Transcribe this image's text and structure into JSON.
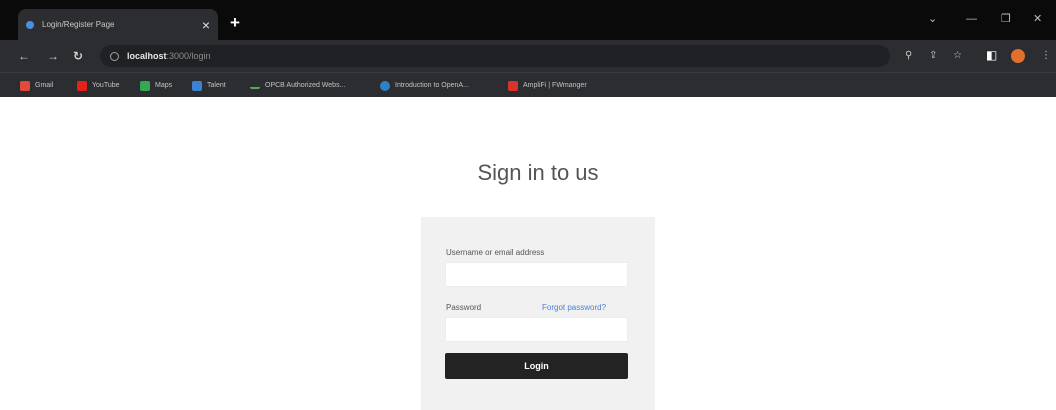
{
  "browser": {
    "tab_title": "Login/Register Page",
    "url_host": "localhost",
    "url_rest": ":3000/login",
    "bookmarks": [
      {
        "label": "Gmail",
        "color": "#e24a3b"
      },
      {
        "label": "YouTube",
        "color": "#e62117"
      },
      {
        "label": "Maps",
        "color": "#34a853"
      },
      {
        "label": "Talent",
        "color": "#3b82d6"
      },
      {
        "label": "OPCB Authorized Webs...",
        "color": "#4caf50"
      },
      {
        "label": "Introduction to OpenA...",
        "color": "#2f80c7"
      },
      {
        "label": "AmpliFi | FWmanger",
        "color": "#d9342b"
      }
    ]
  },
  "page": {
    "heading": "Sign in to us",
    "form": {
      "username_label": "Username or email address",
      "password_label": "Password",
      "forgot_link": "Forgot password?",
      "login_button": "Login"
    }
  }
}
